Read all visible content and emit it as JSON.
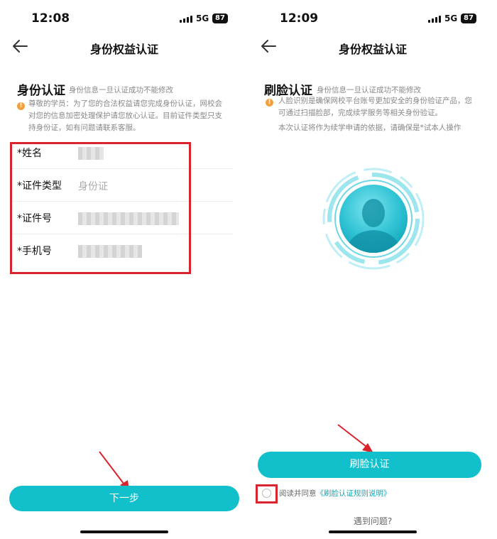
{
  "left": {
    "status": {
      "time": "12:08",
      "network": "5G",
      "battery": "87"
    },
    "nav": {
      "title": "身份权益认证",
      "back_icon": "arrow-left-icon"
    },
    "section": {
      "title": "身份认证",
      "subtitle": "身份信息一旦认证成功不能修改"
    },
    "notice": {
      "line1": "尊敬的学员：为了您的合法权益请您完成身份认证，网校会",
      "line2": "对您的信息加密处理保护请您放心认证。目前证件类型只支",
      "line3": "持身份证，如有问题请联系客服。"
    },
    "form": {
      "name_label": "*姓名",
      "id_type_label": "*证件类型",
      "id_type_value": "身份证",
      "id_number_label": "*证件号",
      "phone_label": "*手机号"
    },
    "next_button": "下一步"
  },
  "right": {
    "status": {
      "time": "12:09",
      "network": "5G",
      "battery": "87"
    },
    "nav": {
      "title": "身份权益认证",
      "back_icon": "arrow-left-icon"
    },
    "section": {
      "title": "刷脸认证",
      "subtitle": "身份信息一旦认证成功不能修改"
    },
    "notice": {
      "line1": "人脸识别是确保网校平台账号更加安全的身份验证产品，您",
      "line2": "可通过扫描脸部，完成续学服务等相关身份验证。",
      "line3": "本次认证将作为续学申请的依据，请确保是*试本人操作"
    },
    "face_icon": "face-scan-icon",
    "face_button": "刷脸认证",
    "agree": {
      "prefix": "阅读并同意",
      "link": "《刷脸认证规则说明》"
    },
    "help": "遇到问题?"
  },
  "colors": {
    "accent": "#12c0cb",
    "annotation_red": "#d9232d",
    "warning": "#f2a03d"
  }
}
